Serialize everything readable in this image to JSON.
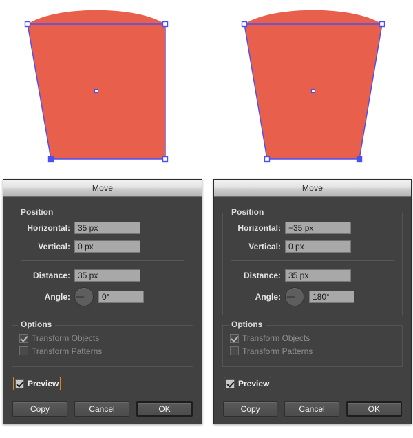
{
  "canvas": {
    "shape_fill": "#E8604C",
    "selection_color": "#4B50F0",
    "anchor_fill": "#ffffff",
    "left_shape": {
      "name": "trapezoid-skewed-left",
      "description": "Orange trapezoid with curved top, left edge slanted inward, selection path shown"
    },
    "right_shape": {
      "name": "trapezoid-symmetric",
      "description": "Orange trapezoid with curved top, both edges slanted inward, selection path shown"
    }
  },
  "dialog_left": {
    "title": "Move",
    "position_group": {
      "legend": "Position",
      "horizontal_label": "Horizontal:",
      "horizontal_value": "35 px",
      "vertical_label": "Vertical:",
      "vertical_value": "0 px",
      "distance_label": "Distance:",
      "distance_value": "35 px",
      "angle_label": "Angle:",
      "angle_value": "0°"
    },
    "options_group": {
      "legend": "Options",
      "transform_objects_label": "Transform Objects",
      "transform_objects_checked": true,
      "transform_patterns_label": "Transform Patterns",
      "transform_patterns_checked": false
    },
    "preview_label": "Preview",
    "preview_checked": true,
    "buttons": {
      "copy": "Copy",
      "cancel": "Cancel",
      "ok": "OK"
    }
  },
  "dialog_right": {
    "title": "Move",
    "position_group": {
      "legend": "Position",
      "horizontal_label": "Horizontal:",
      "horizontal_value": "−35 px",
      "vertical_label": "Vertical:",
      "vertical_value": "0 px",
      "distance_label": "Distance:",
      "distance_value": "35 px",
      "angle_label": "Angle:",
      "angle_value": "180°"
    },
    "options_group": {
      "legend": "Options",
      "transform_objects_label": "Transform Objects",
      "transform_objects_checked": true,
      "transform_patterns_label": "Transform Patterns",
      "transform_patterns_checked": false
    },
    "preview_label": "Preview",
    "preview_checked": true,
    "buttons": {
      "copy": "Copy",
      "cancel": "Cancel",
      "ok": "OK"
    }
  },
  "theme": {
    "dialog_bg": "#414141",
    "field_bg": "#a8a8a8",
    "focus_ring": "#d8861f"
  }
}
